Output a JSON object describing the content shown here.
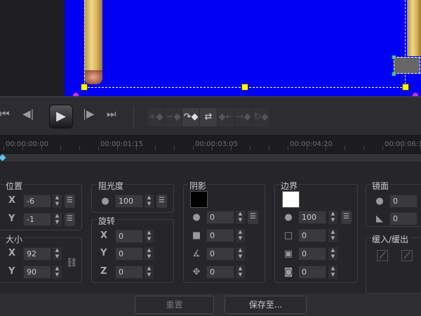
{
  "transport": {
    "play_icon": "▶",
    "buttons": [
      "⏮",
      "◀|",
      "|▶",
      "⏭"
    ]
  },
  "keyframe_tools": [
    "+◆",
    "−◆",
    "↷◆",
    "⇄",
    "◆←",
    "→◆",
    "↻◆"
  ],
  "timeline": {
    "labels": [
      "00:00:00:00",
      "00:00:01:15",
      "00:00:03:05",
      "00:00:04:20",
      "00:00:06:1"
    ]
  },
  "position": {
    "title": "位置",
    "x_label": "X",
    "x": "-6",
    "y_label": "Y",
    "y": "-1"
  },
  "size": {
    "title": "大小",
    "x_label": "X",
    "x": "92",
    "y_label": "Y",
    "y": "90"
  },
  "opacity": {
    "title": "阻光度",
    "value": "100"
  },
  "rotation": {
    "title": "旋转",
    "x_label": "X",
    "x": "0",
    "y_label": "Y",
    "y": "0",
    "z_label": "Z",
    "z": "0"
  },
  "shadow": {
    "title": "阴影",
    "color": "#000000",
    "values": [
      "0",
      "0",
      "0",
      "0"
    ]
  },
  "border": {
    "title": "边界",
    "color": "#ffffff",
    "values": [
      "100",
      "0",
      "0",
      "0"
    ]
  },
  "mirror": {
    "title": "镜面",
    "values": [
      "0",
      "0"
    ]
  },
  "ease": {
    "title": "缓入/缓出"
  },
  "footer": {
    "reset": "重置",
    "save_to": "保存至..."
  }
}
